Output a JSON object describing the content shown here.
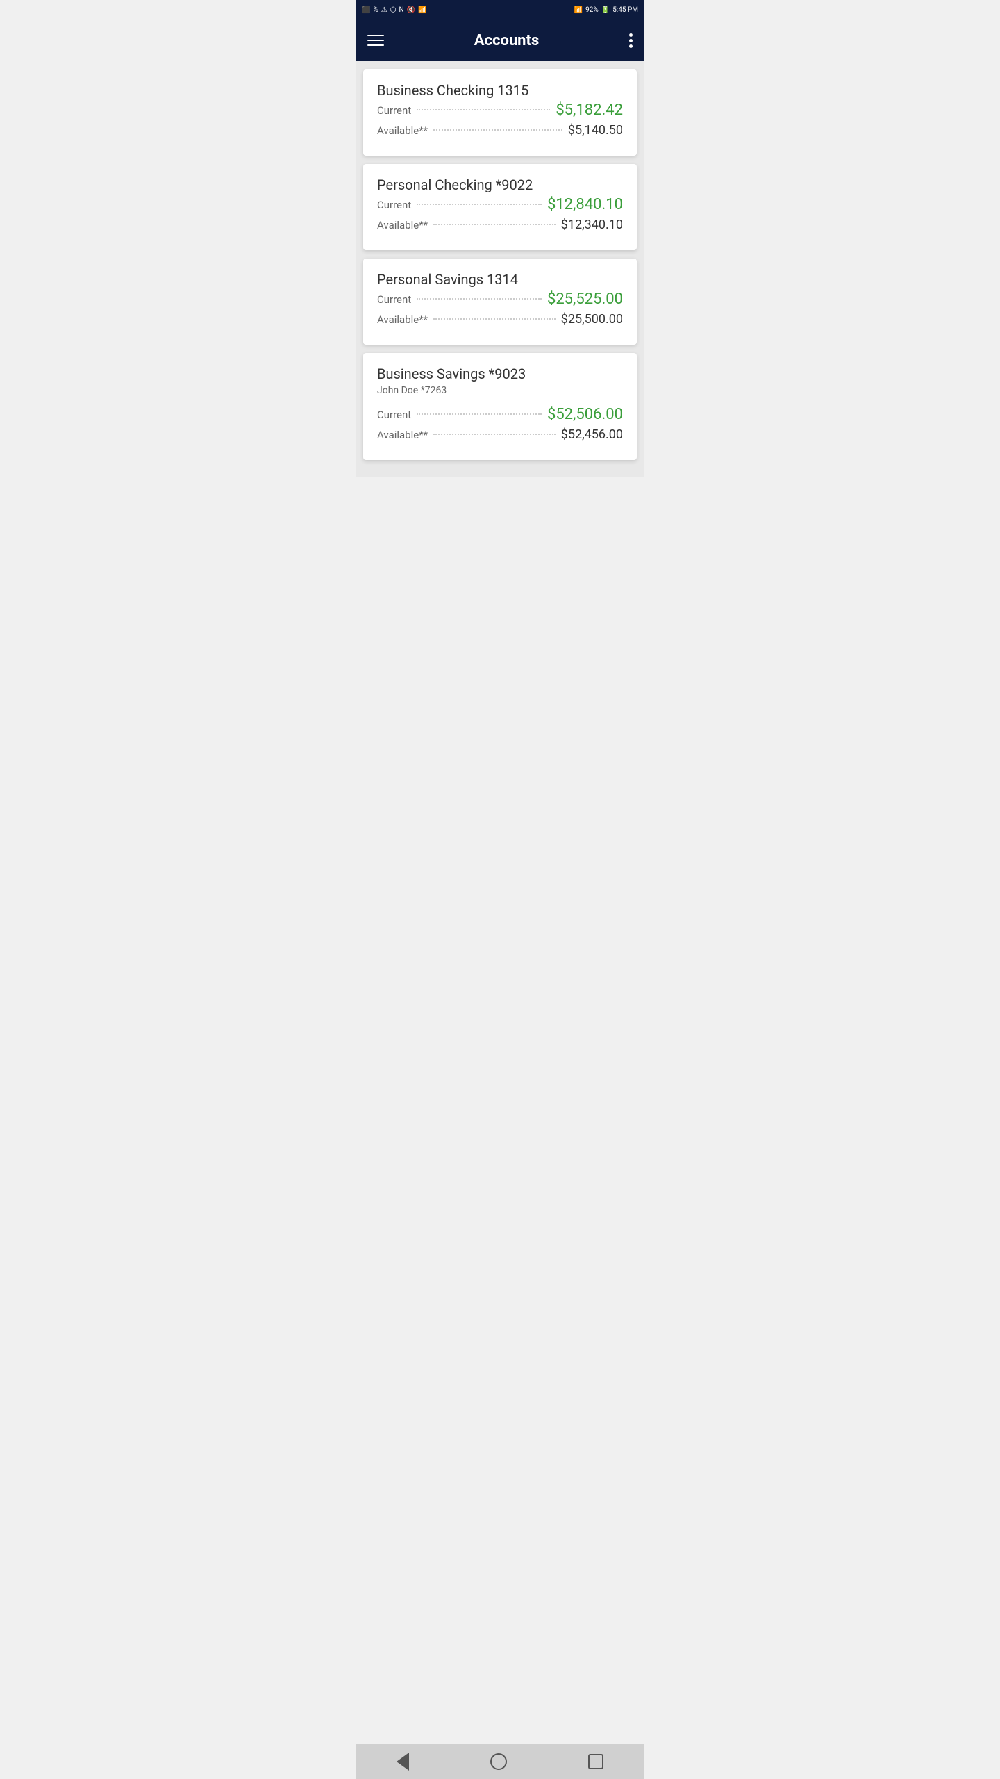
{
  "statusBar": {
    "time": "5:45 PM",
    "battery": "92%",
    "batteryIcon": "battery-icon",
    "wifiIcon": "wifi-icon",
    "signalIcon": "signal-icon",
    "bluetoothIcon": "bluetooth-icon"
  },
  "header": {
    "title": "Accounts",
    "menuIcon": "hamburger-icon",
    "moreIcon": "more-options-icon"
  },
  "accounts": [
    {
      "name": "Business Checking 1315",
      "subLabel": "",
      "currentLabel": "Current",
      "currentAmount": "$5,182.42",
      "availableLabel": "Available**",
      "availableAmount": "$5,140.50"
    },
    {
      "name": "Personal Checking *9022",
      "subLabel": "",
      "currentLabel": "Current",
      "currentAmount": "$12,840.10",
      "availableLabel": "Available**",
      "availableAmount": "$12,340.10"
    },
    {
      "name": "Personal Savings 1314",
      "subLabel": "",
      "currentLabel": "Current",
      "currentAmount": "$25,525.00",
      "availableLabel": "Available**",
      "availableAmount": "$25,500.00"
    },
    {
      "name": "Business Savings *9023",
      "subLabel": "John Doe *7263",
      "currentLabel": "Current",
      "currentAmount": "$52,506.00",
      "availableLabel": "Available**",
      "availableAmount": "$52,456.00"
    }
  ],
  "bottomNav": {
    "backLabel": "back",
    "homeLabel": "home",
    "recentLabel": "recent"
  }
}
